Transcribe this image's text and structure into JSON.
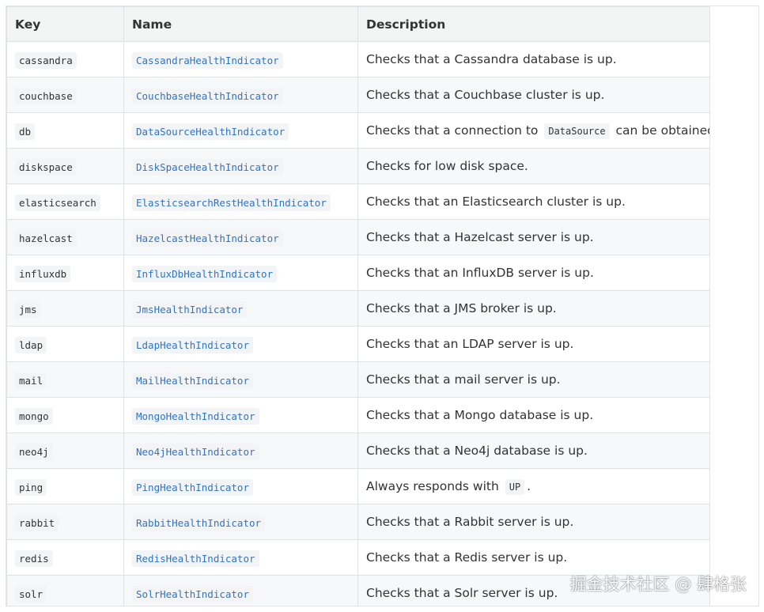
{
  "table": {
    "headers": {
      "key": "Key",
      "name": "Name",
      "description": "Description"
    },
    "rows": [
      {
        "key": "cassandra",
        "name": "CassandraHealthIndicator",
        "desc_before": "Checks that a Cassandra database is up.",
        "desc_code": "",
        "desc_after": ""
      },
      {
        "key": "couchbase",
        "name": "CouchbaseHealthIndicator",
        "desc_before": "Checks that a Couchbase cluster is up.",
        "desc_code": "",
        "desc_after": ""
      },
      {
        "key": "db",
        "name": "DataSourceHealthIndicator",
        "desc_before": "Checks that a connection to",
        "desc_code": "DataSource",
        "desc_after": "can be obtained."
      },
      {
        "key": "diskspace",
        "name": "DiskSpaceHealthIndicator",
        "desc_before": "Checks for low disk space.",
        "desc_code": "",
        "desc_after": ""
      },
      {
        "key": "elasticsearch",
        "name": "ElasticsearchRestHealthIndicator",
        "desc_before": "Checks that an Elasticsearch cluster is up.",
        "desc_code": "",
        "desc_after": ""
      },
      {
        "key": "hazelcast",
        "name": "HazelcastHealthIndicator",
        "desc_before": "Checks that a Hazelcast server is up.",
        "desc_code": "",
        "desc_after": ""
      },
      {
        "key": "influxdb",
        "name": "InfluxDbHealthIndicator",
        "desc_before": "Checks that an InfluxDB server is up.",
        "desc_code": "",
        "desc_after": ""
      },
      {
        "key": "jms",
        "name": "JmsHealthIndicator",
        "desc_before": "Checks that a JMS broker is up.",
        "desc_code": "",
        "desc_after": ""
      },
      {
        "key": "ldap",
        "name": "LdapHealthIndicator",
        "desc_before": "Checks that an LDAP server is up.",
        "desc_code": "",
        "desc_after": ""
      },
      {
        "key": "mail",
        "name": "MailHealthIndicator",
        "desc_before": "Checks that a mail server is up.",
        "desc_code": "",
        "desc_after": ""
      },
      {
        "key": "mongo",
        "name": "MongoHealthIndicator",
        "desc_before": "Checks that a Mongo database is up.",
        "desc_code": "",
        "desc_after": ""
      },
      {
        "key": "neo4j",
        "name": "Neo4jHealthIndicator",
        "desc_before": "Checks that a Neo4j database is up.",
        "desc_code": "",
        "desc_after": ""
      },
      {
        "key": "ping",
        "name": "PingHealthIndicator",
        "desc_before": "Always responds with",
        "desc_code": "UP",
        "desc_after": "."
      },
      {
        "key": "rabbit",
        "name": "RabbitHealthIndicator",
        "desc_before": "Checks that a Rabbit server is up.",
        "desc_code": "",
        "desc_after": ""
      },
      {
        "key": "redis",
        "name": "RedisHealthIndicator",
        "desc_before": "Checks that a Redis server is up.",
        "desc_code": "",
        "desc_after": ""
      },
      {
        "key": "solr",
        "name": "SolrHealthIndicator",
        "desc_before": "Checks that a Solr server is up.",
        "desc_code": "",
        "desc_after": ""
      }
    ]
  },
  "watermark": "掘金技术社区 @ 肆格张",
  "colors": {
    "link": "#2f74c5",
    "header_bg": "#f3f4f4",
    "stripe_bg": "#f6f8fa",
    "code_bg": "#f3f4f6",
    "border": "#dfe2e5"
  }
}
